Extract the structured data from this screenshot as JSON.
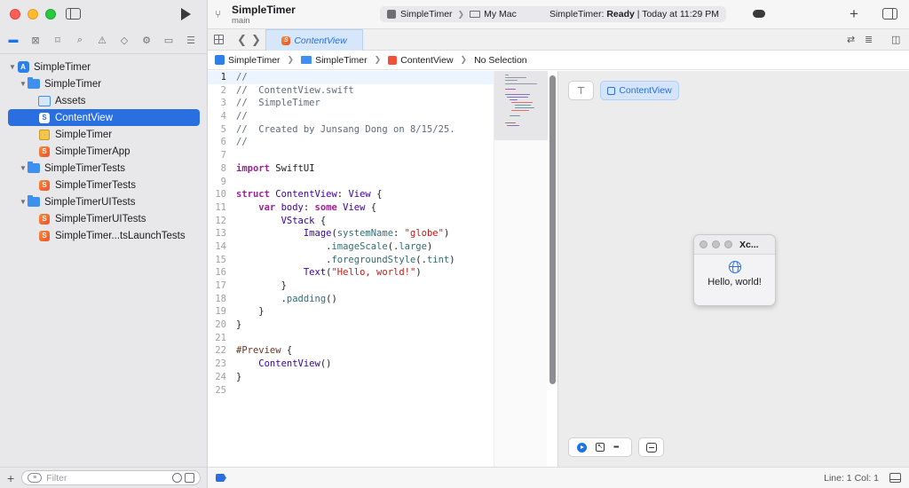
{
  "window": {
    "project": "SimpleTimer",
    "branch": "main"
  },
  "toolbar": {
    "scheme": "SimpleTimer",
    "destination": "My Mac",
    "status_prefix": "SimpleTimer: ",
    "status_state": "Ready",
    "status_suffix": " | Today at 11:29 PM"
  },
  "navigator": {
    "items": [
      {
        "label": "SimpleTimer"
      },
      {
        "label": "SimpleTimer"
      },
      {
        "label": "Assets"
      },
      {
        "label": "ContentView"
      },
      {
        "label": "SimpleTimer"
      },
      {
        "label": "SimpleTimerApp"
      },
      {
        "label": "SimpleTimerTests"
      },
      {
        "label": "SimpleTimerTests"
      },
      {
        "label": "SimpleTimerUITests"
      },
      {
        "label": "SimpleTimerUITests"
      },
      {
        "label": "SimpleTimer...tsLaunchTests"
      }
    ],
    "filter_placeholder": "Filter"
  },
  "tabs": {
    "active": "ContentView"
  },
  "jumpbar": {
    "project": "SimpleTimer",
    "group": "SimpleTimer",
    "file": "ContentView",
    "selection": "No Selection"
  },
  "code": {
    "lines": [
      {
        "n": "1"
      },
      {
        "n": "2"
      },
      {
        "n": "3"
      },
      {
        "n": "4"
      },
      {
        "n": "5"
      },
      {
        "n": "6"
      },
      {
        "n": "7"
      },
      {
        "n": "8"
      },
      {
        "n": "9"
      },
      {
        "n": "10"
      },
      {
        "n": "11"
      },
      {
        "n": "12"
      },
      {
        "n": "13"
      },
      {
        "n": "14"
      },
      {
        "n": "15"
      },
      {
        "n": "16"
      },
      {
        "n": "17"
      },
      {
        "n": "18"
      },
      {
        "n": "19"
      },
      {
        "n": "20"
      },
      {
        "n": "21"
      },
      {
        "n": "22"
      },
      {
        "n": "23"
      },
      {
        "n": "24"
      },
      {
        "n": "25"
      }
    ],
    "tokens": {
      "c1": "//",
      "c2": "//  ContentView.swift",
      "c3": "//  SimpleTimer",
      "c4": "//",
      "c5": "//  Created by Junsang Dong on 8/15/25.",
      "c6": "//",
      "import_kw": "import",
      "import_mod": " SwiftUI",
      "struct_kw": "struct",
      "struct_name": " ContentView",
      "colon1": ": ",
      "view_type": "View",
      "brace1": " {",
      "var_kw": "    var",
      "body_name": " body",
      "colon2": ": ",
      "some_kw": "some",
      "view_type2": " View",
      "brace2": " {",
      "vstack": "        VStack",
      "brace3": " {",
      "image": "            Image",
      "paren1": "(",
      "sysname": "systemName",
      "colon3": ": ",
      "globe": "\"globe\"",
      "paren2": ")",
      "dot1": "                .",
      "imagescale": "imageScale",
      "arg1": "(.",
      "large": "large",
      "paren3": ")",
      "dot2": "                .",
      "fgstyle": "foregroundStyle",
      "arg2": "(.",
      "tint": "tint",
      "paren4": ")",
      "text": "            Text",
      "paren5": "(",
      "hello": "\"Hello, world!\"",
      "paren6": ")",
      "close1": "        }",
      "dot3": "        .",
      "padding": "padding",
      "paren7": "()",
      "close2": "    }",
      "close3": "}",
      "preview_mc": "#Preview",
      "brace4": " {",
      "cv_call": "    ContentView",
      "paren8": "()",
      "close4": "}"
    }
  },
  "preview": {
    "active_preview": "ContentView",
    "window_title": "Xc...",
    "text": "Hello, world!"
  },
  "statusbar": {
    "line_col": "Line: 1  Col: 1"
  },
  "colors": {
    "accent": "#2a6fe0",
    "keyword": "#9b2393",
    "string": "#c41a16",
    "comment": "#5d6c79",
    "type": "#3900a0"
  },
  "icons": [
    "folder-icon",
    "source-control-icon",
    "bookmark-icon",
    "find-icon",
    "issue-icon",
    "test-icon",
    "debug-icon",
    "breakpoint-icon",
    "report-icon",
    "play-icon",
    "plus-icon",
    "inspector-toggle-icon",
    "globe-icon",
    "pin-icon"
  ]
}
